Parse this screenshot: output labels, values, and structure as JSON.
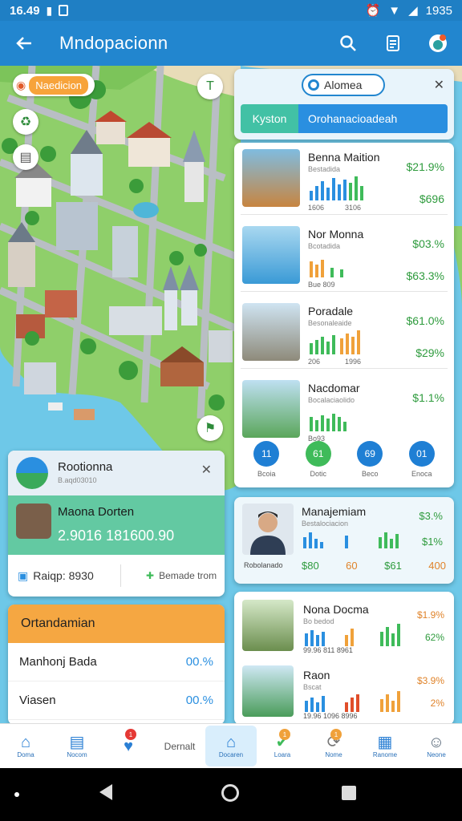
{
  "status": {
    "time": "16.49",
    "battery": "1935"
  },
  "appbar": {
    "title": "Mndopacionn"
  },
  "map": {
    "chip_label": "Naedicion",
    "zoom_label": "T",
    "colors": {
      "water": "#6ec8e8",
      "land": "#8fcf6a",
      "road": "#b9bec4",
      "accent": "#2286cf"
    }
  },
  "search": {
    "value": "Alomea",
    "seg_left": "Kyston",
    "seg_right": "Orohanacioadeah"
  },
  "places": [
    {
      "name": "Benna Maition",
      "sub": "Bestadida",
      "value_top": "$21.9%",
      "value_bottom": "$696",
      "cap_left": "1606",
      "cap_right": "3106"
    },
    {
      "name": "Nor Monna",
      "sub": "Bcotadida",
      "value_top": "$03.%",
      "value_bottom": "$63.3%",
      "cap_left": "Bue 809",
      "cap_right": ""
    },
    {
      "name": "Poradale",
      "sub": "Besonaleaide",
      "value_top": "$61.0%",
      "value_bottom": "$29%",
      "cap_left": "206",
      "cap_right": "1996"
    },
    {
      "name": "Nacdomar",
      "sub": "Bocalaciaolido",
      "value_top": "$1.1%",
      "value_bottom": "",
      "cap_left": "Bo93",
      "cap_right": ""
    }
  ],
  "circles": [
    {
      "value": "11",
      "label": "Bcoia",
      "color": "#1f7fd4"
    },
    {
      "value": "61",
      "label": "Dotic",
      "color": "#3fbb5a"
    },
    {
      "value": "69",
      "label": "Beco",
      "color": "#1f7fd4"
    },
    {
      "value": "01",
      "label": "Enoca",
      "color": "#1f7fd4"
    }
  ],
  "info_card": {
    "title": "Rootionna",
    "subtitle": "B.aqd03010",
    "mid_name": "Maona Dorten",
    "mid_value": "2.9016 181600.90",
    "foot_left": "Raiqp: 8930",
    "foot_right": "Bemade trom"
  },
  "orange_card": {
    "header": "Ortandamian",
    "rows": [
      {
        "label": "Manhonj Bada",
        "value": "00.%"
      },
      {
        "label": "Viasen",
        "value": "00.%"
      }
    ]
  },
  "person_card": {
    "name": "Manajemiam",
    "sub": "Bestalociacion",
    "caption": "Robolanado",
    "right_top": "$3.%",
    "right_bottom": "$1%",
    "nums": [
      "$80",
      "60",
      "$61",
      "400"
    ]
  },
  "small_items": [
    {
      "name": "Nona Docma",
      "sub": "Bo bedod",
      "right_top": "$1.9%",
      "right_bottom": "62%",
      "cap": "99.96  811  8961"
    },
    {
      "name": "Raon",
      "sub": "Bscat",
      "right_top": "$3.9%",
      "right_bottom": "2%",
      "cap": "19.96  1096  8996"
    }
  ],
  "bottom_nav": [
    {
      "icon": "home-icon",
      "glyph": "⌂",
      "label": "Doma"
    },
    {
      "icon": "calendar-icon",
      "glyph": "▤",
      "label": "Nocom"
    },
    {
      "icon": "heart-icon",
      "glyph": "♥",
      "label": "",
      "badge": "1"
    },
    {
      "icon": "",
      "glyph": "",
      "label": "Dernalt",
      "text_only": true
    },
    {
      "icon": "map-icon",
      "glyph": "⌂",
      "label": "Docaren",
      "active": true
    },
    {
      "icon": "check-icon",
      "glyph": "✔",
      "label": "Loara",
      "badge": "1"
    },
    {
      "icon": "sync-icon",
      "glyph": "⟳",
      "label": "Nome",
      "badge": "1"
    },
    {
      "icon": "grid-icon",
      "glyph": "▦",
      "label": "Ranome"
    },
    {
      "icon": "person-icon",
      "glyph": "☺",
      "label": "Neone"
    }
  ]
}
